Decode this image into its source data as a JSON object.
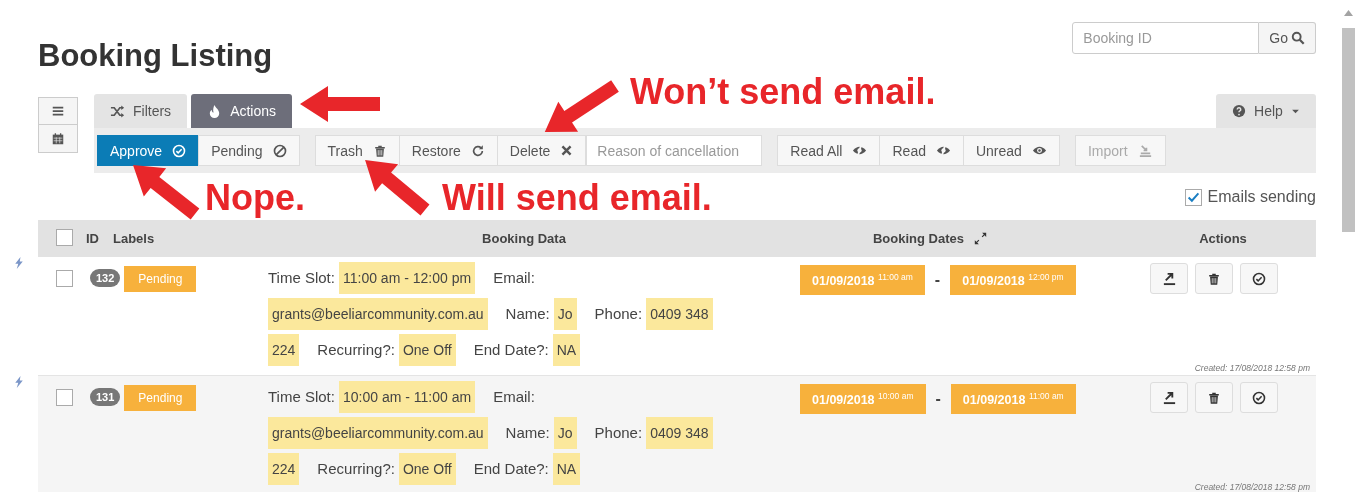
{
  "page_title": "Booking Listing",
  "search": {
    "placeholder": "Booking ID",
    "button": "Go"
  },
  "tabs": [
    {
      "label": "Filters",
      "selected": false
    },
    {
      "label": "Actions",
      "selected": true
    }
  ],
  "help_menu": {
    "label": "Help"
  },
  "toolbar": {
    "groups": [
      {
        "buttons": [
          {
            "label": "Approve",
            "primary": true,
            "disabled": false
          },
          {
            "label": "Pending",
            "primary": false,
            "disabled": false
          }
        ]
      },
      {
        "buttons": [
          {
            "label": "Trash",
            "primary": false,
            "disabled": false
          },
          {
            "label": "Restore",
            "primary": false,
            "disabled": false
          },
          {
            "label": "Delete",
            "primary": false,
            "disabled": false
          }
        ],
        "field": {
          "placeholder": "Reason of cancellation"
        }
      },
      {
        "buttons": [
          {
            "label": "Read All",
            "primary": false,
            "disabled": false
          },
          {
            "label": "Read",
            "primary": false,
            "disabled": false
          },
          {
            "label": "Unread",
            "primary": false,
            "disabled": false
          }
        ]
      },
      {
        "buttons": [
          {
            "label": "Import",
            "primary": false,
            "disabled": true
          }
        ]
      }
    ]
  },
  "emails_sending": {
    "label": "Emails sending",
    "checked": true
  },
  "table": {
    "columns": [
      "ID",
      "Labels",
      "Booking Data",
      "Booking Dates",
      "Actions"
    ],
    "select_all": {
      "checked": false
    },
    "rows": [
      {
        "checked": false,
        "id": "132",
        "status": "Pending",
        "lines": [
          [
            {
              "label": "Time Slot:",
              "value": "11:00 am - 12:00 pm"
            },
            {
              "label": "Email:"
            }
          ],
          [
            {
              "value": "grants@beeliarcommunity.com.au"
            },
            {
              "label": "Name:",
              "value": "Jo"
            },
            {
              "label": "Phone:",
              "value": "0409 348"
            }
          ],
          [
            {
              "value": "224"
            },
            {
              "label": "Recurring?:",
              "value": "One Off"
            },
            {
              "label": "End Date?:",
              "value": "NA"
            }
          ]
        ],
        "start": "01/09/2018 $^{11:00 am}$",
        "separator": "-",
        "end": "01/09/2018 $^{12:00 pm}$",
        "created": "Created: 17/08/2018 12:58 pm"
      },
      {
        "checked": false,
        "id": "131",
        "status": "Pending",
        "lines": [
          [
            {
              "label": "Time Slot:",
              "value": "10:00 am - 11:00 am"
            },
            {
              "label": "Email:"
            }
          ],
          [
            {
              "value": "grants@beeliarcommunity.com.au"
            },
            {
              "label": "Name:",
              "value": "Jo"
            },
            {
              "label": "Phone:",
              "value": "0409 348"
            }
          ],
          [
            {
              "value": "224"
            },
            {
              "label": "Recurring?:",
              "value": "One Off"
            },
            {
              "label": "End Date?:",
              "value": "NA"
            }
          ]
        ],
        "start": "01/09/2018 $^{10:00 am}$",
        "separator": "-",
        "end": "01/09/2018 $^{11:00 am}$",
        "created": "Created: 17/08/2018 12:58 pm"
      }
    ]
  },
  "annotations": [
    {
      "text": "Won’t send email."
    },
    {
      "text": "Nope."
    },
    {
      "text": "Will send email."
    }
  ]
}
